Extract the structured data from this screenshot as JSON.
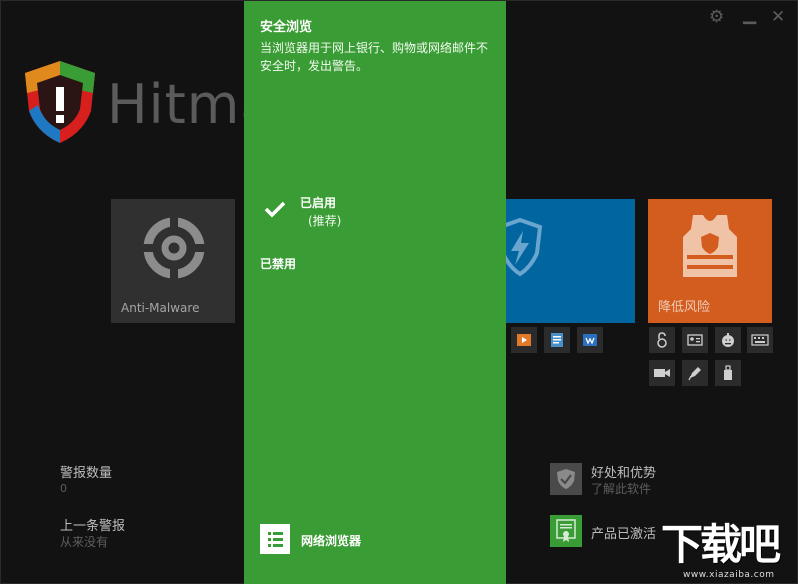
{
  "window": {
    "settings_icon": "gear-icon",
    "minimize_label": "▁",
    "close_label": "✕"
  },
  "brand": {
    "name": "Hitma"
  },
  "tiles": {
    "anti_malware": {
      "label": "Anti-Malware"
    },
    "reduce_risk": {
      "label": "降低风险"
    }
  },
  "stats": {
    "alert_count": {
      "title": "警报数量",
      "value": "0"
    },
    "last_alert": {
      "title": "上一条警报",
      "value": "从来没有"
    }
  },
  "bottom_right": {
    "benefits": {
      "title": "好处和优势",
      "subtitle": "了解此软件"
    },
    "activated": {
      "title": "产品已激活"
    }
  },
  "panel": {
    "title": "安全浏览",
    "description": "当浏览器用于网上银行、购物或网络邮件不安全时，发出警告。",
    "option_enabled": "已启用",
    "option_enabled_note": "(推荐)",
    "option_disabled": "已禁用",
    "footer_label": "网络浏览器"
  },
  "watermark": {
    "big": "下载吧",
    "small": "www.xiazaiba.com"
  },
  "colors": {
    "panel_green": "#3a9c34",
    "tile_blue": "#0166a0",
    "tile_orange": "#d35c1f",
    "background": "#121212"
  }
}
